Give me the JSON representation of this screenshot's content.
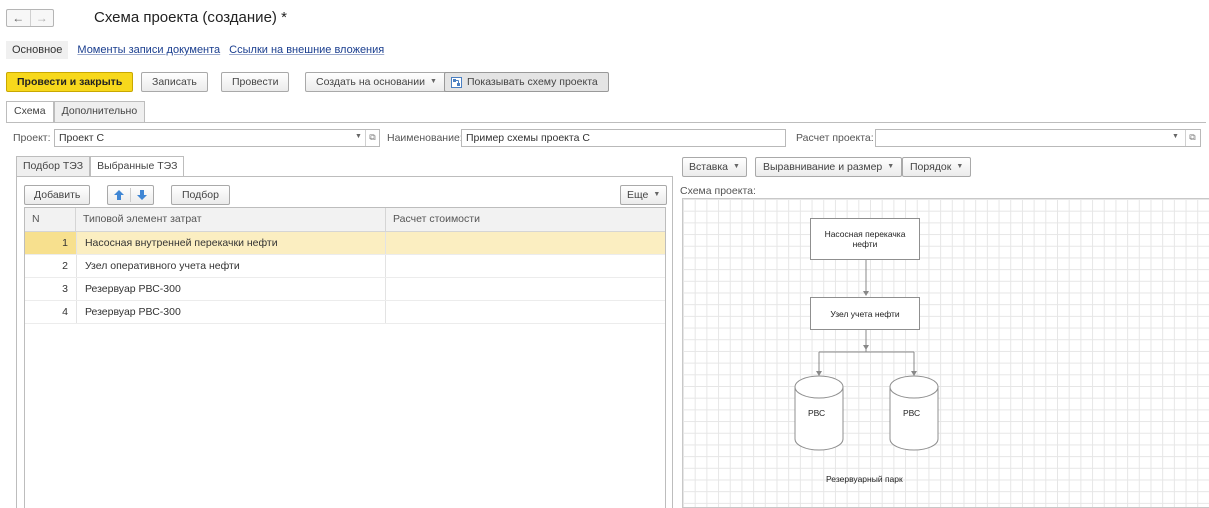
{
  "window": {
    "title": "Схема проекта (создание) *",
    "back_glyph": "←",
    "forward_glyph": "→"
  },
  "top_links": {
    "main": "Основное",
    "moments": "Моменты записи документа",
    "links": "Ссылки на внешние вложения"
  },
  "toolbar": {
    "post_close": "Провести и закрыть",
    "save": "Записать",
    "post": "Провести",
    "create_basis": "Создать на основании",
    "show_scheme": "Показывать схему проекта"
  },
  "tabs": [
    "Схема",
    "Дополнительно"
  ],
  "form": {
    "project_label": "Проект:",
    "project_value": "Проект С",
    "name_label": "Наименование:",
    "name_value": "Пример схемы проекта С",
    "calc_label": "Расчет проекта:",
    "calc_value": ""
  },
  "left_tabs": [
    "Подбор ТЭЗ",
    "Выбранные ТЭЗ"
  ],
  "left_toolbar": {
    "add": "Добавить",
    "pick": "Подбор",
    "more": "Еще"
  },
  "table": {
    "headers": [
      "N",
      "Типовой элемент затрат",
      "Расчет стоимости"
    ],
    "rows": [
      {
        "n": "1",
        "element": "Насосная внутренней перекачки нефти",
        "calc": ""
      },
      {
        "n": "2",
        "element": "Узел оперативного учета нефти",
        "calc": ""
      },
      {
        "n": "3",
        "element": "Резервуар РВС-300",
        "calc": ""
      },
      {
        "n": "4",
        "element": "Резервуар РВС-300",
        "calc": ""
      }
    ]
  },
  "right_toolbar": {
    "insert": "Вставка",
    "align": "Выравнивание и размер",
    "order": "Порядок"
  },
  "scheme": {
    "label": "Схема проекта:",
    "node1": "Насосная перекачка нефти",
    "node2": "Узел учета нефти",
    "tank1": "РВС",
    "tank2": "РВС",
    "park": "Резервуарный парк"
  },
  "colors": {
    "primary_button": "#f7d81c",
    "selected_row": "#fbeec1",
    "link": "#1a3e8f"
  }
}
